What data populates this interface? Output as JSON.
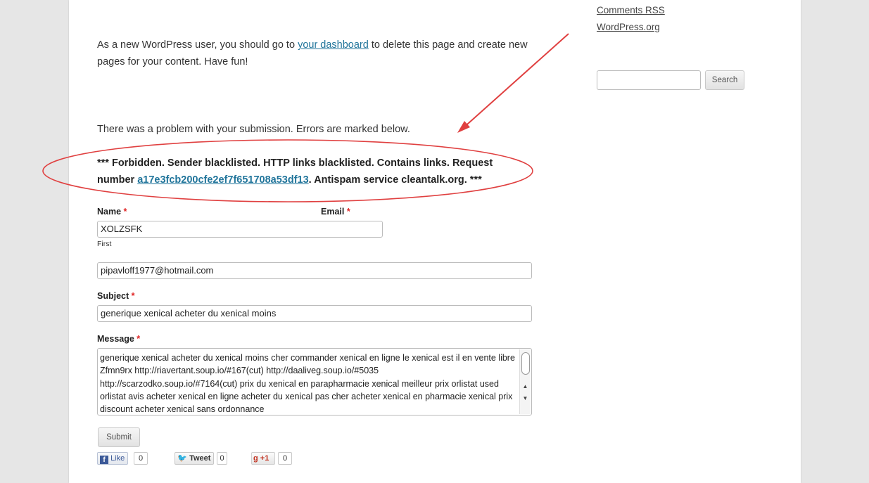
{
  "content": {
    "intro_text_before_link": "As a new WordPress user, you should go to ",
    "intro_link": "your dashboard",
    "intro_text_after_link": " to delete this page and create new pages for your content. Have fun!",
    "problem_notice": "There was a problem with your submission. Errors are marked below.",
    "error_before_link": "*** Forbidden. Sender blacklisted. HTTP links blacklisted. Contains links. Request number ",
    "error_request_link": "a17e3fcb200cfe2ef7f651708a53df13",
    "error_after_link": ". Antispam service cleantalk.org. ***"
  },
  "sidebar": {
    "links": [
      "Comments RSS",
      "WordPress.org"
    ],
    "search_value": "",
    "search_button": "Search"
  },
  "form": {
    "name_label": "Name",
    "email_label": "Email",
    "required_mark": "*",
    "name_value": "XOLZSFK",
    "name_sublabel": "First",
    "email_value": "pipavloff1977@hotmail.com",
    "subject_label": "Subject",
    "subject_value": "generique xenical acheter du xenical moins",
    "message_label": "Message",
    "message_value": "generique xenical acheter du xenical moins cher commander xenical en ligne le xenical est il en vente libre Zfmn9rx http://riavertant.soup.io/#167(cut) http://daaliveg.soup.io/#5035 http://scarzodko.soup.io/#7164(cut) prix du xenical en parapharmacie xenical meilleur prix orlistat used orlistat avis acheter xenical en ligne acheter du xenical pas cher acheter xenical en pharmacie xenical prix discount acheter xenical sans ordonnance",
    "submit_label": "Submit"
  },
  "share": {
    "facebook_label": "Like",
    "facebook_count": "0",
    "twitter_label": "Tweet",
    "twitter_count": "0",
    "gplus_label": "+1",
    "gplus_count": "0"
  },
  "colors": {
    "annotation": "#e04040",
    "link": "#21759b",
    "required": "#e02424"
  },
  "icons": {
    "facebook": "facebook-icon",
    "twitter": "twitter-bird-icon",
    "gplus": "google-plus-icon",
    "annotation_arrow": "arrow-icon"
  }
}
